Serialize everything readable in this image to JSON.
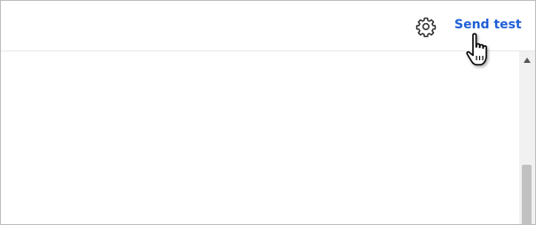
{
  "toolbar": {
    "settings_icon": "gear-icon",
    "send_test_label": "Send test",
    "link_color": "#1f5fd6"
  },
  "cursor": {
    "icon": "hand-pointer-icon"
  }
}
